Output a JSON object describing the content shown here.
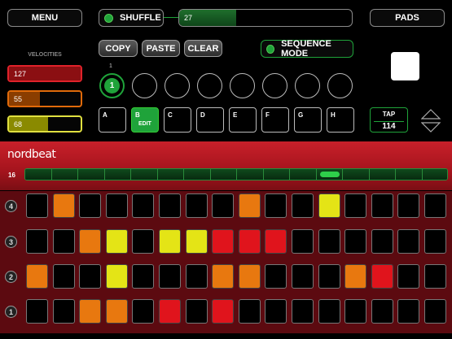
{
  "top": {
    "menu_label": "MENU",
    "shuffle_label": "SHUFFLE",
    "shuffle_value": "27",
    "shuffle_fraction": 0.33,
    "pads_label": "PADS"
  },
  "edit": {
    "copy_label": "COPY",
    "paste_label": "PASTE",
    "clear_label": "CLEAR",
    "sequence_mode_label": "SEQUENCE MODE"
  },
  "velocities": {
    "title": "VELOCITIES",
    "items": [
      {
        "value": "127",
        "fraction": 1.0,
        "color": "#8b0f12",
        "border": "#e0222a"
      },
      {
        "value": "55",
        "fraction": 0.43,
        "color": "#8a3d00",
        "border": "#e06a0a"
      },
      {
        "value": "68",
        "fraction": 0.54,
        "color": "#8a8a00",
        "border": "#e0e040"
      }
    ]
  },
  "sequence": {
    "step_number": "1",
    "active_label": "1",
    "slots": 8
  },
  "patterns": {
    "items": [
      "A",
      "B",
      "C",
      "D",
      "E",
      "F",
      "G",
      "H"
    ],
    "active_index": 1,
    "edit_label": "EDIT"
  },
  "tap": {
    "label": "TAP",
    "value": "114"
  },
  "brand": {
    "name": "nordbeat"
  },
  "steps": {
    "count_label": "16",
    "position": 11
  },
  "lanes": [
    "4",
    "3",
    "2",
    "1"
  ],
  "grid": [
    [
      0,
      2,
      0,
      0,
      0,
      0,
      0,
      0,
      2,
      0,
      0,
      3,
      0,
      0,
      0,
      0
    ],
    [
      0,
      0,
      2,
      3,
      0,
      3,
      3,
      1,
      1,
      1,
      0,
      0,
      0,
      0,
      0,
      0
    ],
    [
      2,
      0,
      0,
      3,
      0,
      0,
      0,
      2,
      2,
      0,
      0,
      0,
      2,
      1,
      0,
      0
    ],
    [
      0,
      0,
      2,
      2,
      0,
      1,
      0,
      1,
      0,
      0,
      0,
      0,
      0,
      0,
      0,
      0
    ]
  ],
  "colors": {
    "off": "#000000",
    "red": "#e0141c",
    "orange": "#e8780f",
    "yellow": "#e4e416",
    "green": "#1fa33a"
  }
}
